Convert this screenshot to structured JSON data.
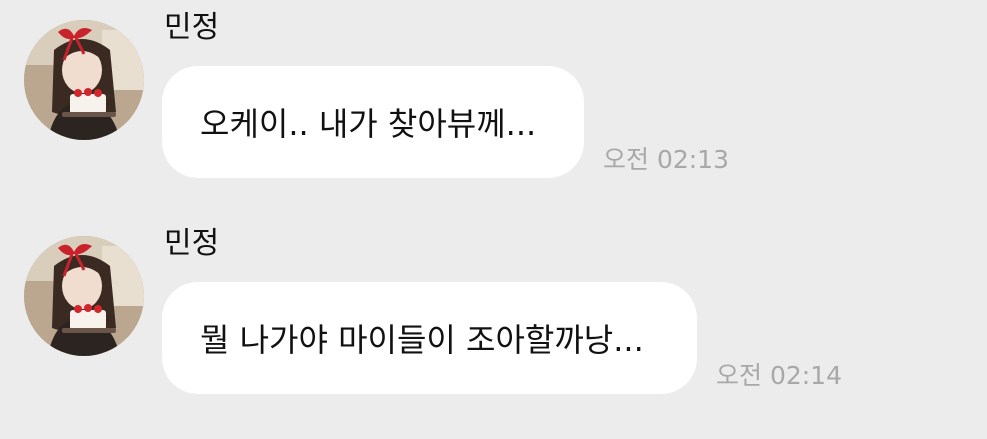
{
  "messages": [
    {
      "sender": "민정",
      "text": "오케이.. 내가 찾아뷰께...",
      "time": "오전 02:13",
      "avatar_icon": "profile-photo"
    },
    {
      "sender": "민정",
      "text": "뭘 나가야 마이들이 조아할까낭...",
      "time": "오전 02:14",
      "avatar_icon": "profile-photo"
    }
  ],
  "colors": {
    "background": "#ececec",
    "bubble": "#ffffff",
    "timestamp": "#a8a8a8",
    "text": "#111111"
  }
}
